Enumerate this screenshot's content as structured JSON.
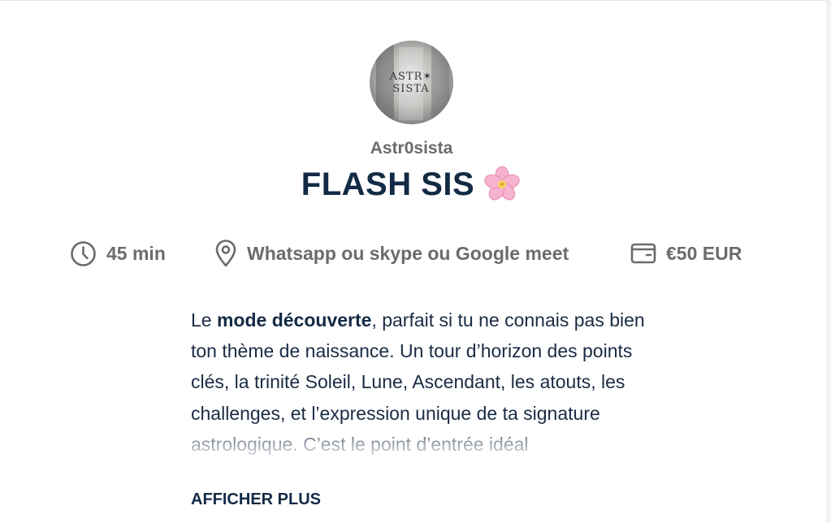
{
  "host": {
    "name": "Astr0sista",
    "logo_text": "ASTR✶ SISTA"
  },
  "service": {
    "title": "FLASH SIS",
    "title_emoji": "cherry-blossom-icon"
  },
  "meta": {
    "duration": "45 min",
    "location": "Whatsapp ou skype ou Google meet",
    "price": "€50 EUR"
  },
  "description": {
    "prefix": "Le ",
    "bold": "mode découverte",
    "suffix": ", parfait si tu ne connais pas bien ton thème de naissance. Un tour d’horizon des points clés, la trinité Soleil, Lune, Ascendant, les atouts, les challenges, et l’expression unique de ta signature astrologique. C’est le point d’entrée idéal"
  },
  "actions": {
    "show_more": "AFFICHER PLUS"
  },
  "colors": {
    "title": "#132a45",
    "meta_text": "#6b6b6b",
    "flower": "#f4a6c8"
  }
}
